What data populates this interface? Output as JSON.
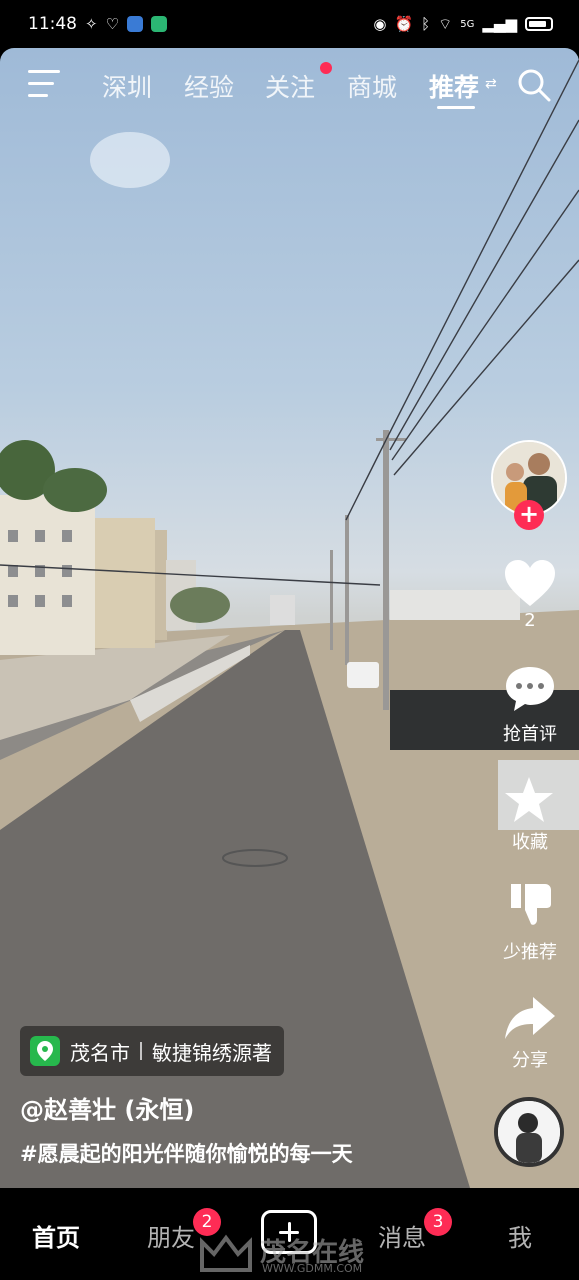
{
  "status_bar": {
    "time": "11:48",
    "network": "5G",
    "icons": [
      "eye-icon",
      "alarm-icon",
      "bluetooth-icon",
      "wifi-icon",
      "signal-icon",
      "battery-icon"
    ]
  },
  "top_nav": {
    "tabs": [
      {
        "label": "深圳",
        "active": false
      },
      {
        "label": "经验",
        "active": false
      },
      {
        "label": "关注",
        "active": false,
        "dot": true
      },
      {
        "label": "商城",
        "active": false
      },
      {
        "label": "推荐",
        "active": true
      }
    ],
    "menu_icon": "menu-icon",
    "search_icon": "search-icon"
  },
  "right_rail": {
    "like_count": "2",
    "comment_label": "抢首评",
    "favorite_label": "收藏",
    "dislike_label": "少推荐",
    "share_label": "分享"
  },
  "location": {
    "city": "茂名市",
    "place": "敏捷锦绣源著"
  },
  "author": "@赵善壮 (永恒)",
  "caption": "#愿晨起的阳光伴随你愉悦的每一天",
  "bottom_bar": {
    "home": "首页",
    "friends": "朋友",
    "friends_badge": "2",
    "messages": "消息",
    "messages_badge": "3",
    "me": "我"
  },
  "watermark": {
    "text": "茂名在线",
    "url": "WWW.GDMM.COM"
  },
  "colors": {
    "accent": "#fe2c55",
    "location_pin": "#27b84d"
  }
}
